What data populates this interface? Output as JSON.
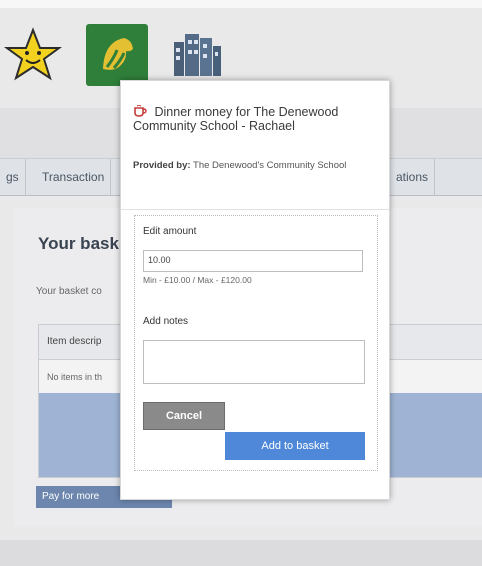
{
  "tabs": [
    {
      "label": "gs"
    },
    {
      "label": "Transaction"
    },
    {
      "label": "ations"
    }
  ],
  "basket": {
    "title": "Your bask",
    "description": "Your basket co",
    "table_header": "Item descrip",
    "empty_text": "No items in th",
    "pay_button": "Pay for more"
  },
  "modal": {
    "title": "Dinner money for The Denewood Community School - Rachael",
    "provider_label": "Provided by:",
    "provider_value": "The Denewood's Community School",
    "edit_amount_label": "Edit amount",
    "amount_value": "10.00",
    "min_max": "Min - £10.00 / Max - £120.00",
    "notes_label": "Add notes",
    "notes_value": "",
    "cancel_label": "Cancel",
    "add_label": "Add to basket"
  },
  "colors": {
    "accent": "#4f88d9",
    "cancel": "#8a8a8a",
    "header_bg": "#e0e0e2"
  },
  "icons": [
    "star-icon",
    "lion-logo-icon",
    "building-icon",
    "cup-icon"
  ]
}
